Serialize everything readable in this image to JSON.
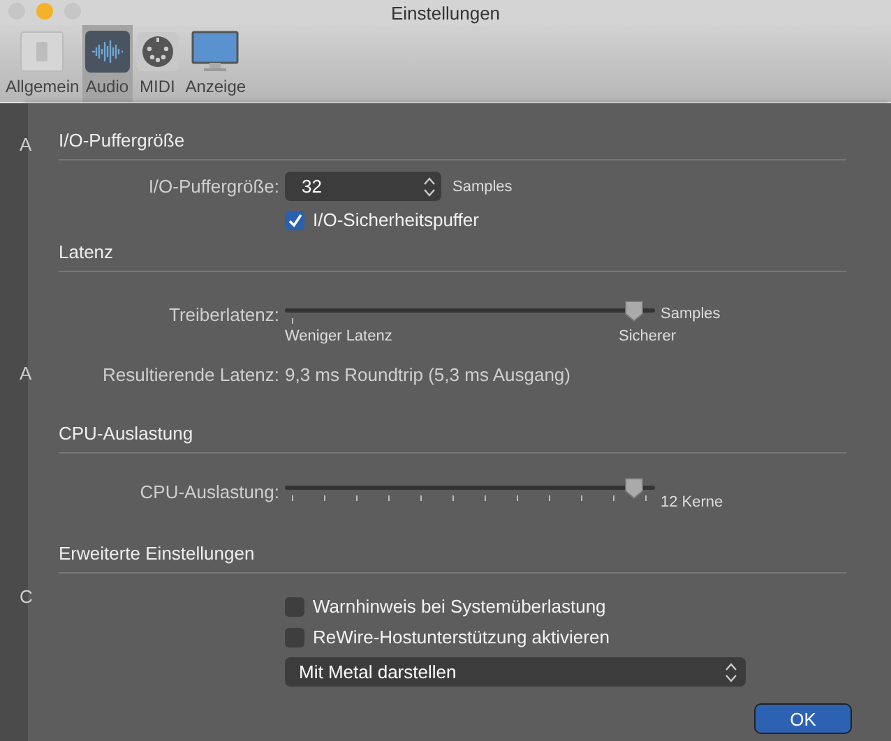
{
  "window": {
    "title": "Einstellungen"
  },
  "tabs": [
    {
      "label": "Allgemein",
      "kind": "general",
      "selected": false
    },
    {
      "label": "Audio",
      "kind": "audio",
      "selected": true
    },
    {
      "label": "MIDI",
      "kind": "midi",
      "selected": false
    },
    {
      "label": "Anzeige",
      "kind": "display",
      "selected": false
    }
  ],
  "background_letters": [
    "A",
    "A",
    "C"
  ],
  "buffer": {
    "heading": "I/O-Puffergröße",
    "label": "I/O-Puffergröße:",
    "value": "32",
    "unit": "Samples",
    "safety": {
      "label": "I/O-Sicherheitspuffer",
      "checked": true
    }
  },
  "latency": {
    "heading": "Latenz",
    "label": "Treiberlatenz:",
    "level": 0.97,
    "unit": "Samples",
    "min_label": "Weniger Latenz",
    "max_label": "Sicherer",
    "result_label": "Resultierende Latenz:",
    "result": "9,3 ms Roundtrip (5,3 ms Ausgang)"
  },
  "cpu": {
    "heading": "CPU-Auslastung",
    "label": "CPU-Auslastung:",
    "level": 0.97,
    "reading": "12 Kerne"
  },
  "advanced": {
    "heading": "Erweiterte Einstellungen",
    "options": [
      {
        "label": "Warnhinweis bei Systemüberlastung",
        "checked": false
      },
      {
        "label": "ReWire-Hostunterstützung aktivieren",
        "checked": false
      }
    ],
    "renderer": "Mit Metal darstellen"
  },
  "buttons": [
    {
      "label": "OK",
      "kind": "default"
    }
  ]
}
